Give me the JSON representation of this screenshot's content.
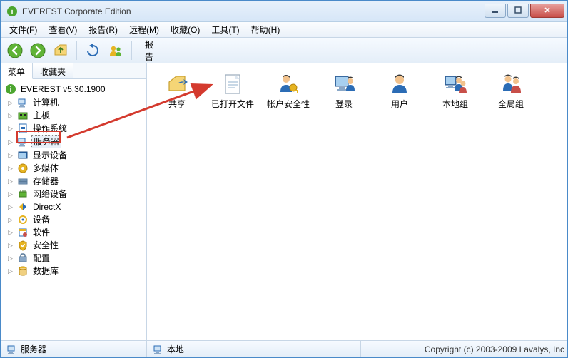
{
  "window": {
    "title": "EVEREST Corporate Edition"
  },
  "menu": {
    "file": "文件(F)",
    "view": "查看(V)",
    "report": "报告(R)",
    "remote": "远程(M)",
    "favorites": "收藏(O)",
    "tools": "工具(T)",
    "help": "帮助(H)"
  },
  "toolbar": {
    "report_label": "报告"
  },
  "tabs": {
    "menu": "菜单",
    "favorites": "收藏夹"
  },
  "tree": {
    "root": "EVEREST v5.30.1900",
    "items": [
      "计算机",
      "主板",
      "操作系统",
      "服务器",
      "显示设备",
      "多媒体",
      "存储器",
      "网络设备",
      "DirectX",
      "设备",
      "软件",
      "安全性",
      "配置",
      "数据库"
    ],
    "selected_index": 3
  },
  "content": {
    "items": [
      {
        "label": "共享",
        "icon": "share"
      },
      {
        "label": "已打开文件",
        "icon": "opened-file"
      },
      {
        "label": "帐户安全性",
        "icon": "account-security"
      },
      {
        "label": "登录",
        "icon": "logon"
      },
      {
        "label": "用户",
        "icon": "user"
      },
      {
        "label": "本地组",
        "icon": "local-group"
      },
      {
        "label": "全局组",
        "icon": "global-group"
      }
    ]
  },
  "status": {
    "left": "服务器",
    "mid": "本地",
    "copyright": "Copyright (c) 2003-2009 Lavalys, Inc"
  }
}
